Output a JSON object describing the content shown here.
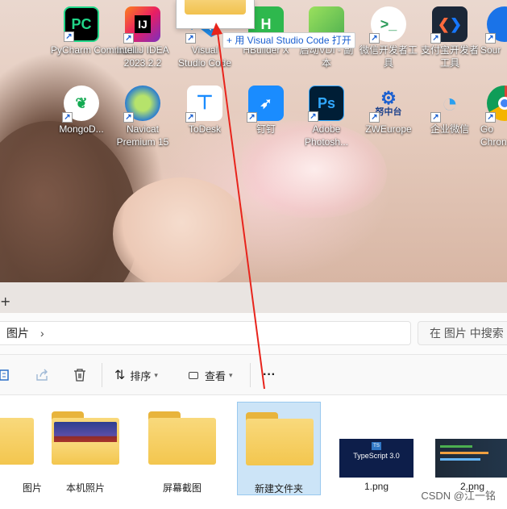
{
  "desktop": {
    "icons_row1": [
      {
        "label": "PyCharm Communi...",
        "glyph": "PC",
        "color": "#21d789",
        "bg": "#000"
      },
      {
        "label": "IntelliJ IDEA 2023.2.2",
        "glyph": "IJ",
        "color": "#fff",
        "bg": "#000"
      },
      {
        "label": "Visual Studio Code",
        "glyph": "",
        "color": "#1e88e5",
        "bg": "transparent"
      },
      {
        "label": "HBuilder X",
        "glyph": "H",
        "color": "#fff",
        "bg": "#2eb84d"
      },
      {
        "label": "启动VDI - 副本",
        "glyph": "",
        "color": "#fff",
        "bg": "#4caf50"
      },
      {
        "label": "微信开发者工具",
        "glyph": ">_",
        "color": "#2c9b5a",
        "bg": "#fff"
      },
      {
        "label": "支付宝开发者工具",
        "glyph": "❮❯",
        "color": "#fff",
        "bg": "#1b2738"
      },
      {
        "label": "Sour...",
        "glyph": "",
        "color": "#fff",
        "bg": "#1a73e8"
      }
    ],
    "icons_row2": [
      {
        "label": "MongoD...",
        "glyph": "❦",
        "color": "#13aa52",
        "bg": "#fff"
      },
      {
        "label": "Navicat Premium 15",
        "glyph": "N",
        "color": "#2a7dd1",
        "bg": "transparent"
      },
      {
        "label": "ToDesk",
        "glyph": "T",
        "color": "#1a8cff",
        "bg": "#fff"
      },
      {
        "label": "钉钉",
        "glyph": "➶",
        "color": "#fff",
        "bg": "#1a8cff"
      },
      {
        "label": "Adobe Photosh...",
        "glyph": "Ps",
        "color": "#31a8ff",
        "bg": "#001e36"
      },
      {
        "label": "ZWEurope",
        "glyph": "",
        "color": "#1a5fd0",
        "bg": "transparent"
      },
      {
        "label": "企业微信",
        "glyph": "◔",
        "color": "#2aa0f0",
        "bg": "transparent"
      },
      {
        "label": "Go... Chron...",
        "glyph": "",
        "color": "#fff",
        "bg": "transparent"
      }
    ],
    "zw_sub": "努中台",
    "tooltip": "+ 用 Visual Studio Code 打开",
    "shortcut_arrow": "↗"
  },
  "explorer": {
    "add_tab": "+",
    "breadcrumb": "图片",
    "breadcrumb_chevron": "›",
    "search_placeholder": "在 图片 中搜索",
    "toolbar": {
      "sort_label": "排序",
      "view_label": "查看",
      "more_label": "···"
    },
    "items": [
      {
        "name": "图片",
        "type": "folder"
      },
      {
        "name": "本机照片",
        "type": "folder-photo"
      },
      {
        "name": "屏幕截图",
        "type": "folder"
      },
      {
        "name": "新建文件夹",
        "type": "folder",
        "selected": true
      },
      {
        "name": "1.png",
        "type": "image",
        "thumb_text": "TypeScript 3.0"
      },
      {
        "name": "2.png",
        "type": "image",
        "thumb_text": ""
      }
    ]
  },
  "watermark": "CSDN @江一铭"
}
